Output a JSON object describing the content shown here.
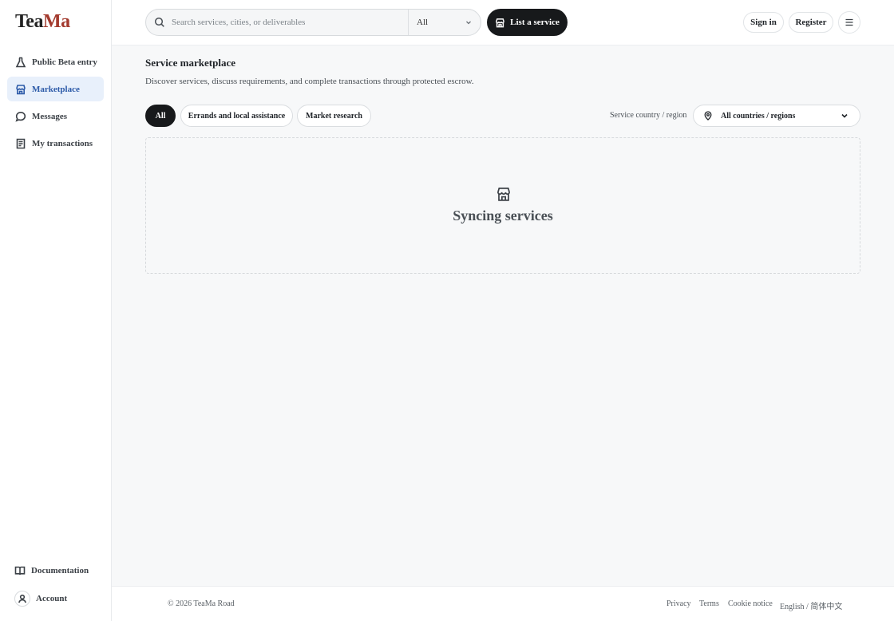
{
  "brand": {
    "part1": "Tea",
    "part2": "Ma",
    "color_part2": "#a33a2e"
  },
  "sidebar": {
    "items": [
      {
        "label": "Public Beta entry",
        "icon": "flask-icon",
        "active": false
      },
      {
        "label": "Marketplace",
        "icon": "store-icon",
        "active": true
      },
      {
        "label": "Messages",
        "icon": "chat-bubble-icon",
        "active": false
      },
      {
        "label": "My transactions",
        "icon": "receipt-icon",
        "active": false
      }
    ],
    "bottom": [
      {
        "label": "Documentation",
        "icon": "book-icon"
      },
      {
        "label": "Account",
        "icon": "user-icon"
      }
    ]
  },
  "header": {
    "search_placeholder": "Search services, cities, or deliverables",
    "search_value": "",
    "filter_selected": "All",
    "list_service_label": "List a service",
    "sign_in_label": "Sign in",
    "register_label": "Register"
  },
  "main": {
    "title": "Service marketplace",
    "subtitle": "Discover services, discuss requirements, and complete transactions through protected escrow.",
    "categories": [
      {
        "label": "All",
        "active": true
      },
      {
        "label": "Errands and local assistance",
        "active": false
      },
      {
        "label": "Market research",
        "active": false
      }
    ],
    "region_label": "Service country / region",
    "region_selected": "All countries / regions",
    "empty_state_text": "Syncing services"
  },
  "footer": {
    "copyright": "© 2026 TeaMa Road",
    "links": [
      "Privacy",
      "Terms",
      "Cookie notice",
      "English / 简体中文"
    ]
  },
  "colors": {
    "accent": "#2c5aa8",
    "active_nav_bg": "#e8f0fb",
    "primary_button": "#17191b"
  }
}
